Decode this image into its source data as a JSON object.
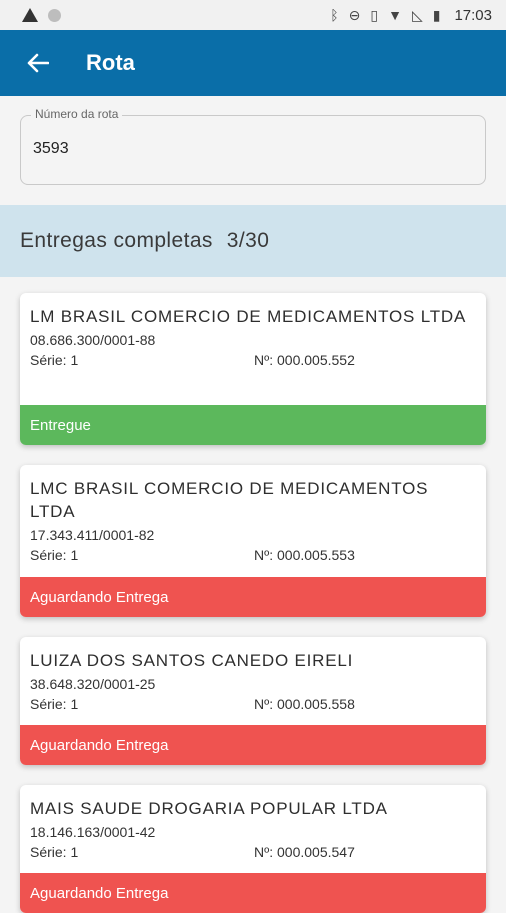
{
  "statusbar": {
    "time": "17:03"
  },
  "appbar": {
    "title": "Rota"
  },
  "route": {
    "label": "Número da rota",
    "value": "3593"
  },
  "summary": {
    "label": "Entregas completas",
    "count": "3/30"
  },
  "deliveries": [
    {
      "name": "LM BRASIL COMERCIO DE MEDICAMENTOS LTDA",
      "cnpj": "08.686.300/0001-88",
      "serie": "Série: 1",
      "numero": "Nº: 000.005.552",
      "status": "Entregue",
      "status_color": "#5cb85c"
    },
    {
      "name": "LMC BRASIL COMERCIO DE MEDICAMENTOS LTDA",
      "cnpj": "17.343.411/0001-82",
      "serie": "Série: 1",
      "numero": "Nº: 000.005.553",
      "status": "Aguardando Entrega",
      "status_color": "#ef5350"
    },
    {
      "name": "LUIZA DOS SANTOS CANEDO EIRELI",
      "cnpj": "38.648.320/0001-25",
      "serie": "Série: 1",
      "numero": "Nº: 000.005.558",
      "status": "Aguardando Entrega",
      "status_color": "#ef5350"
    },
    {
      "name": "MAIS SAUDE DROGARIA POPULAR LTDA",
      "cnpj": "18.146.163/0001-42",
      "serie": "Série: 1",
      "numero": "Nº: 000.005.547",
      "status": "Aguardando Entrega",
      "status_color": "#ef5350"
    }
  ]
}
